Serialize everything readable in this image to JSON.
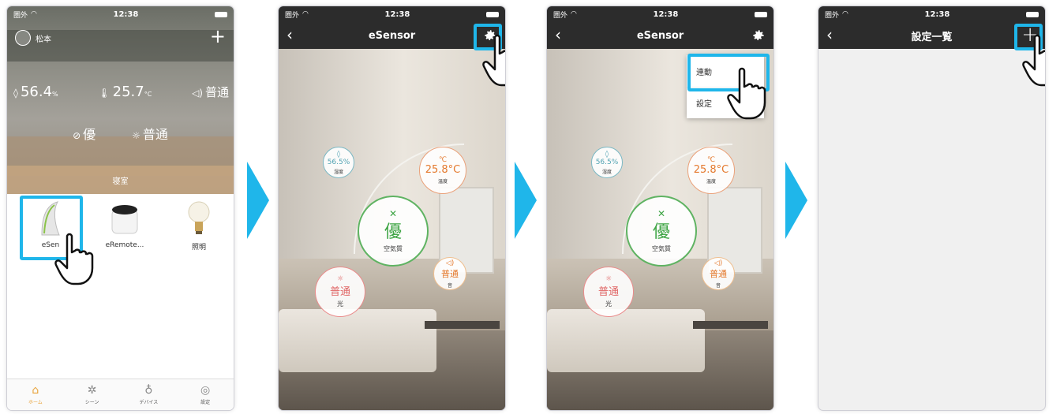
{
  "status": {
    "carrier": "圏外",
    "time": "12:38"
  },
  "screen1": {
    "user_name": "松本",
    "humidity": "56.4",
    "humidity_unit": "%",
    "temperature": "25.7",
    "temperature_unit": "°C",
    "sound": "普通",
    "air_quality": "優",
    "light": "普通",
    "room_name": "寝室",
    "devices": [
      {
        "label": "eSen",
        "icon": "esensor-icon"
      },
      {
        "label": "eRemote...",
        "icon": "eremote-icon"
      },
      {
        "label": "照明",
        "icon": "bulb-icon"
      }
    ],
    "tabs": [
      {
        "label": "ホーム",
        "icon": "home-icon",
        "active": true
      },
      {
        "label": "シーン",
        "icon": "scene-icon",
        "active": false
      },
      {
        "label": "デバイス",
        "icon": "device-icon",
        "active": false
      },
      {
        "label": "設定",
        "icon": "settings-icon",
        "active": false
      }
    ]
  },
  "screen2": {
    "title": "eSensor",
    "humidity": "56.5%",
    "humidity_label": "湿度",
    "temperature": "25.8°C",
    "temperature_label": "温度",
    "air": "優",
    "air_label": "空気質",
    "sound": "普通",
    "sound_label": "音",
    "light": "普通",
    "light_label": "光"
  },
  "screen3": {
    "title": "eSensor",
    "menu": [
      "連動",
      "設定"
    ]
  },
  "screen4": {
    "title": "設定一覧"
  },
  "colors": {
    "highlight": "#1fb6ea",
    "arrow": "#1fb6ea",
    "accent_home": "#e8a33a"
  }
}
